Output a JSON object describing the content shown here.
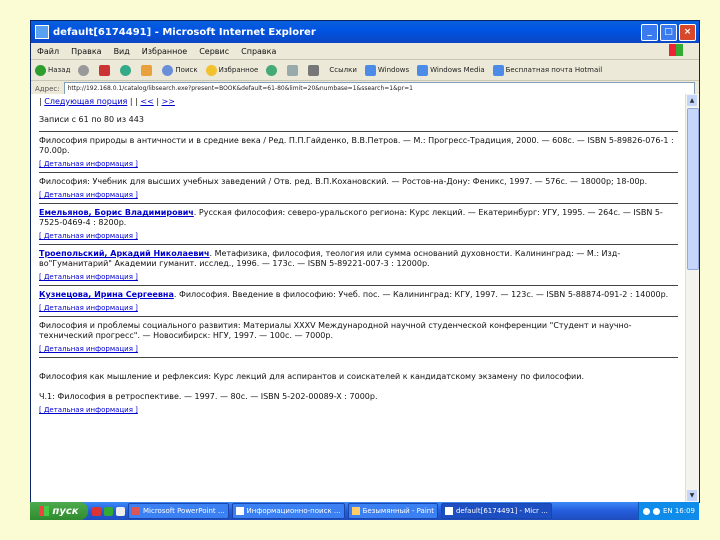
{
  "window": {
    "title": "default[6174491] - Microsoft Internet Explorer",
    "controls": [
      "_",
      "□",
      "×"
    ]
  },
  "menu": [
    "Файл",
    "Правка",
    "Вид",
    "Избранное",
    "Сервис",
    "Справка"
  ],
  "toolbar": {
    "back": "Назад",
    "search": "Поиск",
    "favorites": "Избранное",
    "links": [
      "Ссылки",
      "Windows",
      "Windows Media",
      "Бесплатная почта Hotmail"
    ]
  },
  "address": {
    "label": "Адрес:",
    "url": "http://192.168.0.1/catalog/libsearch.exe?present=BOOK&default=61-80&limit=20&numbase=1&ssearch=1&pr=1"
  },
  "nav": {
    "sep1": "|",
    "first": "Следующая порция",
    "sep2": "| |",
    "prev": "<<",
    "sep3": "|",
    "next": ">>"
  },
  "count": "Записи с 61 по 80 из 443",
  "more_label": "[ Детальная информация ]",
  "records": [
    {
      "author": "",
      "text": "Философия природы в античности и в средние века / Ред. П.П.Гайденко, В.В.Петров. — М.: Прогресс-Традиция, 2000. — 608с. — ISBN 5-89826-076-1 : 70.00р."
    },
    {
      "author": "",
      "text": "Философия: Учебник для высших учебных заведений / Отв. ред. В.П.Кохановский. — Ростов-на-Дону: Феникс, 1997. — 576с. — 18000р; 18-00р."
    },
    {
      "author": "Емельянов, Борис Владимирович",
      "text": ". Русская философия: северо-уральского региона: Курс лекций. — Екатеринбург: УГУ, 1995. — 264с. — ISBN 5-7525-0469-4 : 8200р."
    },
    {
      "author": "Троепольский, Аркадий Николаевич",
      "text": ". Метафизика, философия, теология или сумма оснований духовности. Калининград: — М.: Изд-во\"Гуманитарий\" Академии гуманит. исслед., 1996. — 173с. — ISBN 5-89221-007-3 : 12000р."
    },
    {
      "author": "Кузнецова, Ирина Сергеевна",
      "text": ". Философия. Введение в философию: Учеб. пос. — Калининград: КГУ, 1997. — 123с. — ISBN 5-88874-091-2 : 14000р."
    },
    {
      "author": "",
      "text": "Философия и проблемы социального развития: Материалы XXXV Международной научной студенческой конференции \"Студент и научно-технический прогресс\". — Новосибирск: НГУ, 1997. — 100с. — 7000р."
    },
    {
      "author": "",
      "text": "Философия как мышление и рефлексия: Курс лекций для аспирантов и соискателей к кандидатскому экзамену по философии.\n\nЧ.1: Философия в ретроспективе. — 1997. — 80с. — ISBN 5-202-00089-X : 7000р."
    }
  ],
  "taskbar": {
    "start": "пуск",
    "tasks": [
      "Microsoft PowerPoint ...",
      "Информационно-поиск ...",
      "Безымянный - Paint",
      "default[6174491] - Micr ..."
    ],
    "clock": "EN 16:09"
  }
}
